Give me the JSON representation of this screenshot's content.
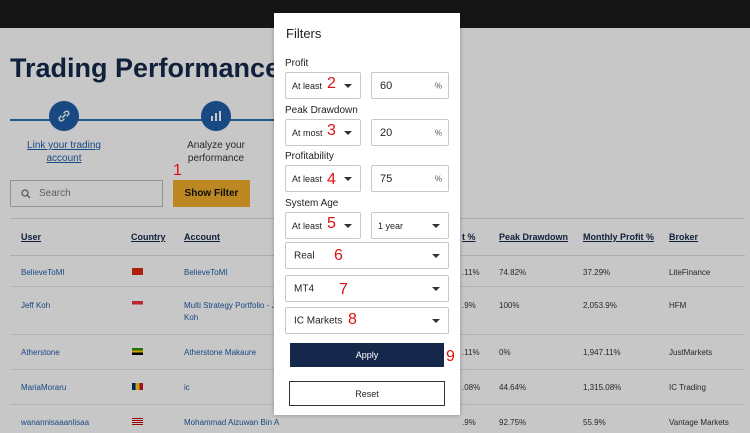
{
  "page": {
    "title": "Trading Performance",
    "steps": [
      {
        "label": "Link your trading account"
      },
      {
        "label": "Analyze your performance"
      }
    ],
    "search_placeholder": "Search",
    "show_filter_label": "Show Filter"
  },
  "table": {
    "columns": [
      "User",
      "Country",
      "Account",
      "t %",
      "Peak Drawdown",
      "Monthly Profit %",
      "Broker"
    ],
    "rows": [
      {
        "user": "BelieveToMI",
        "country_flag": "china-flag",
        "account": "BelieveToMI",
        "pct": ".11%",
        "drawdown": "74.82%",
        "monthly": "37.29%",
        "broker": "LiteFinance"
      },
      {
        "user": "Jeff Koh",
        "country_flag": "singapore-flag",
        "account": "Multi Strategy Portfolio - Je",
        "account2": "Koh",
        "pct": ".9%",
        "drawdown": "100%",
        "monthly": "2,053.9%",
        "broker": "HFM"
      },
      {
        "user": "Atherstone",
        "country_flag": "zimbabwe-flag",
        "account": "Atherstone Makaure",
        "pct": ".11%",
        "drawdown": "0%",
        "monthly": "1,947.11%",
        "broker": "JustMarkets"
      },
      {
        "user": "MariaMoraru",
        "country_flag": "romania-flag",
        "account": "ic",
        "pct": ".08%",
        "drawdown": "44.64%",
        "monthly": "1,315.08%",
        "broker": "IC Trading"
      },
      {
        "user": "wanannisaaanlisaa",
        "country_flag": "malaysia-flag",
        "account": "Mohammad Aizuwan Bin A",
        "pct": ".9%",
        "drawdown": "92.75%",
        "monthly": "55.9%",
        "broker": "Vantage Markets"
      }
    ]
  },
  "filters": {
    "title": "Filters",
    "profit": {
      "label": "Profit",
      "operator": "At least",
      "value": "60",
      "unit": "%"
    },
    "drawdown": {
      "label": "Peak Drawdown",
      "operator": "At most",
      "value": "20",
      "unit": "%"
    },
    "profitability": {
      "label": "Profitability",
      "operator": "At least",
      "value": "75",
      "unit": "%"
    },
    "system_age": {
      "label": "System Age",
      "operator": "At least",
      "value": "1 year"
    },
    "account_type": "Real",
    "platform": "MT4",
    "broker": "IC Markets",
    "apply_label": "Apply",
    "reset_label": "Reset"
  },
  "annotations": [
    "1",
    "2",
    "3",
    "4",
    "5",
    "6",
    "7",
    "8",
    "9"
  ],
  "colors": {
    "accent": "#15284b",
    "show_filter": "#f2ad2c",
    "annotation": "#e01010",
    "link": "#1f5ea8"
  }
}
